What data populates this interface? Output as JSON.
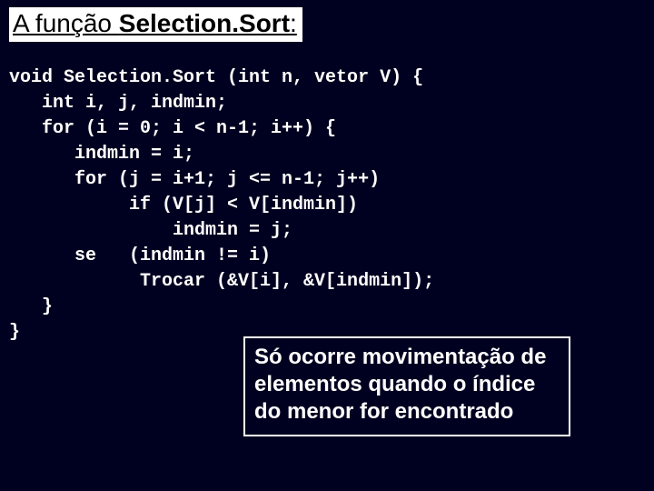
{
  "title": {
    "prefix": "A função ",
    "bold": "Selection.Sort",
    "suffix": ":"
  },
  "code": "void Selection.Sort (int n, vetor V) {\n   int i, j, indmin;\n   for (i = 0; i < n-1; i++) {\n      indmin = i;\n      for (j = i+1; j <= n-1; j++)\n           if (V[j] < V[indmin])\n               indmin = j;\n      se   (indmin != i)\n            Trocar (&V[i], &V[indmin]);\n   }\n}",
  "note": "Só ocorre movimentação de elementos quando o índice do menor for encontrado"
}
